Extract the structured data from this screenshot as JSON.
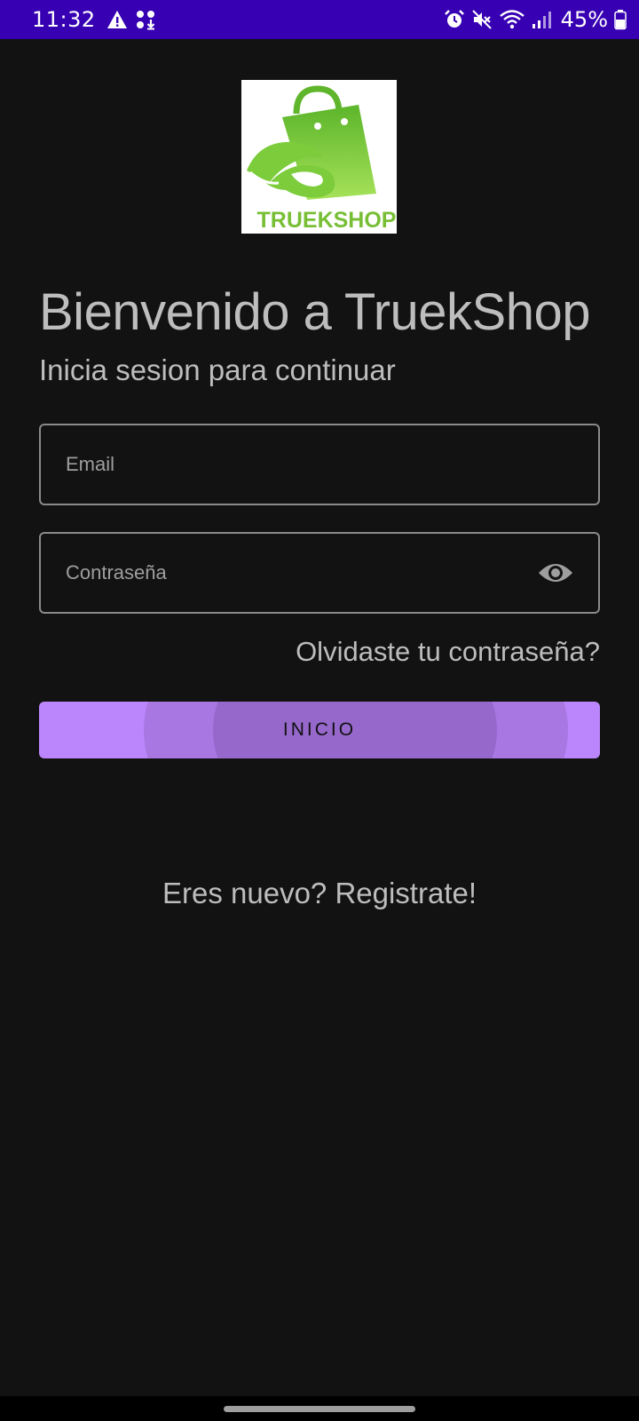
{
  "status_bar": {
    "time": "11:32",
    "battery_text": "45%",
    "left_icons": [
      "warning-icon",
      "download-icon"
    ],
    "right_icons": [
      "alarm-icon",
      "mute-icon",
      "wifi-icon",
      "signal-icon",
      "battery-icon"
    ]
  },
  "logo": {
    "text": "TRUEKSHOP"
  },
  "welcome": {
    "title": "Bienvenido a TruekShop",
    "subtitle": "Inicia sesion para continuar"
  },
  "form": {
    "email_placeholder": "Email",
    "password_placeholder": "Contraseña",
    "forgot_label": "Olvidaste tu contraseña?",
    "login_label": "INICIO",
    "register_label": "Eres nuevo? Registrate!"
  },
  "colors": {
    "status_bar": "#3700b3",
    "background": "#121212",
    "button": "#bb86fc",
    "logo_green": "#7ccc3c"
  }
}
